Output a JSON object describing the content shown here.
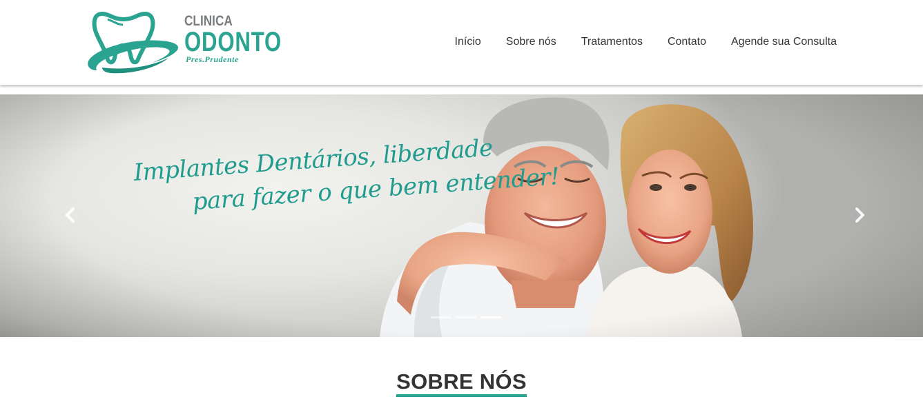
{
  "header": {
    "logo": {
      "clinica": "CLINICA",
      "odonto": "ODONTO",
      "sub": "Pres.Prudente",
      "icon": "tooth-logo-icon"
    },
    "nav": [
      {
        "label": "Início"
      },
      {
        "label": "Sobre nós"
      },
      {
        "label": "Tratamentos"
      },
      {
        "label": "Contato"
      },
      {
        "label": "Agende sua Consulta"
      }
    ]
  },
  "carousel": {
    "slogan_line1": "Implantes Dentários, liberdade",
    "slogan_line2": "para fazer o que bem entender!",
    "prev_icon": "chevron-left-icon",
    "next_icon": "chevron-right-icon",
    "slide_count": 3,
    "active_slide": 3
  },
  "sections": {
    "about_title": "SOBRE NÓS"
  },
  "colors": {
    "brand_teal": "#2aa390",
    "text_dark": "#333333",
    "logo_gray": "#7a7d80"
  }
}
